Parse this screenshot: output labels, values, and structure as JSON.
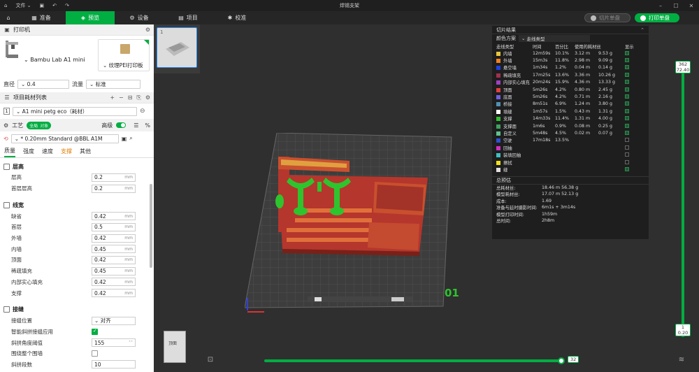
{
  "titlebar": {
    "file_menu": "文件",
    "title": "焊锡支架"
  },
  "nav": {
    "tabs": [
      "准备",
      "预览",
      "设备",
      "项目",
      "校准"
    ],
    "active_tab": "预览",
    "slice_button": "切片单盘",
    "print_button": "打印单盘"
  },
  "printer_section": {
    "title": "打印机",
    "printer_name": "Bambu Lab A1 mini",
    "plate_type": "纹理PEI打印板",
    "nozzle_label": "直径",
    "nozzle_value": "0.4",
    "flow_label": "流量",
    "flow_value": "标准"
  },
  "filament_section": {
    "title": "项目耗材列表",
    "index": "1",
    "filament": "A1 mini petg eco（耗材）"
  },
  "process_section": {
    "title": "工艺",
    "toggle_on": "全局",
    "toggle_off": "对象",
    "advanced_label": "高级",
    "preset": "* 0.20mm Standard @BBL A1M",
    "subtabs": [
      "质量",
      "强度",
      "速度",
      "支撑",
      "其他"
    ],
    "active_subtab": "质量",
    "warn_subtab": "支撑"
  },
  "settings": {
    "layer_height": {
      "title": "层高",
      "rows": [
        {
          "label": "层高",
          "value": "0.2",
          "unit": "mm"
        },
        {
          "label": "首层层高",
          "value": "0.2",
          "unit": "mm"
        }
      ]
    },
    "line_width": {
      "title": "线宽",
      "rows": [
        {
          "label": "缺省",
          "value": "0.42",
          "unit": "mm"
        },
        {
          "label": "首层",
          "value": "0.5",
          "unit": "mm"
        },
        {
          "label": "外墙",
          "value": "0.42",
          "unit": "mm"
        },
        {
          "label": "内墙",
          "value": "0.45",
          "unit": "mm"
        },
        {
          "label": "顶面",
          "value": "0.42",
          "unit": "mm"
        },
        {
          "label": "稀疏填充",
          "value": "0.45",
          "unit": "mm"
        },
        {
          "label": "内部实心填充",
          "value": "0.42",
          "unit": "mm"
        },
        {
          "label": "支撑",
          "value": "0.42",
          "unit": "mm"
        }
      ]
    },
    "seam": {
      "title": "接缝",
      "position_label": "接缝位置",
      "position_value": "对齐",
      "smart_label": "智能斜拼接缝应用",
      "angle_label": "斜拼角度阈值",
      "angle_value": "155",
      "wrap_label": "围绕整个围墙",
      "steps_label": "斜拼段数",
      "steps_value": "10"
    }
  },
  "slice_result": {
    "title": "切片结果",
    "scheme_label": "颜色方案",
    "scheme_value": "走线类型",
    "headers": [
      "走线类型",
      "时间",
      "百分比",
      "使用的耗材丝",
      "显示"
    ],
    "rows": [
      {
        "name": "内墙",
        "color": "#e8c540",
        "time": "12m59s",
        "pct": "10.1%",
        "len": "3.12 m",
        "wt": "9.53 g",
        "show": true
      },
      {
        "name": "外墙",
        "color": "#f08020",
        "time": "15m3s",
        "pct": "11.8%",
        "len": "2.98 m",
        "wt": "9.09 g",
        "show": true
      },
      {
        "name": "悬空墙",
        "color": "#2040e0",
        "time": "1m34s",
        "pct": "1.2%",
        "len": "0.04 m",
        "wt": "0.14 g",
        "show": true
      },
      {
        "name": "稀疏填充",
        "color": "#a03050",
        "time": "17m25s",
        "pct": "13.6%",
        "len": "3.36 m",
        "wt": "10.26 g",
        "show": true
      },
      {
        "name": "内部实心填充",
        "color": "#a040c0",
        "time": "20m24s",
        "pct": "15.9%",
        "len": "4.36 m",
        "wt": "13.33 g",
        "show": true
      },
      {
        "name": "顶面",
        "color": "#e04040",
        "time": "5m26s",
        "pct": "4.2%",
        "len": "0.80 m",
        "wt": "2.45 g",
        "show": true
      },
      {
        "name": "底面",
        "color": "#7060e0",
        "time": "5m26s",
        "pct": "4.2%",
        "len": "0.71 m",
        "wt": "2.16 g",
        "show": true
      },
      {
        "name": "桥接",
        "color": "#5090b0",
        "time": "8m51s",
        "pct": "6.9%",
        "len": "1.24 m",
        "wt": "3.80 g",
        "show": true
      },
      {
        "name": "填缝",
        "color": "#ffffff",
        "time": "1m57s",
        "pct": "1.5%",
        "len": "0.43 m",
        "wt": "1.31 g",
        "show": true
      },
      {
        "name": "支撑",
        "color": "#30c030",
        "time": "14m33s",
        "pct": "11.4%",
        "len": "1.31 m",
        "wt": "4.00 g",
        "show": true
      },
      {
        "name": "支撑面",
        "color": "#40a060",
        "time": "1m6s",
        "pct": "0.9%",
        "len": "0.08 m",
        "wt": "0.25 g",
        "show": true
      },
      {
        "name": "自定义",
        "color": "#60c090",
        "time": "5m48s",
        "pct": "4.5%",
        "len": "0.02 m",
        "wt": "0.07 g",
        "show": true
      },
      {
        "name": "空驶",
        "color": "#3050d0",
        "time": "17m18s",
        "pct": "13.5%",
        "len": "",
        "wt": "",
        "show": false
      },
      {
        "name": "回抽",
        "color": "#d030c0",
        "time": "",
        "pct": "",
        "len": "",
        "wt": "",
        "show": false
      },
      {
        "name": "装填回抽",
        "color": "#40c0c0",
        "time": "",
        "pct": "",
        "len": "",
        "wt": "",
        "show": false
      },
      {
        "name": "擦拭",
        "color": "#f0e020",
        "time": "",
        "pct": "",
        "len": "",
        "wt": "",
        "show": false
      },
      {
        "name": "缝",
        "color": "#e0e0e0",
        "time": "",
        "pct": "",
        "len": "",
        "wt": "",
        "show": true
      }
    ],
    "overview_title": "总预估",
    "overview": [
      {
        "k": "总耗材丝:",
        "v": "18.46 m    56.38 g"
      },
      {
        "k": "模型耗材丝:",
        "v": "17.07 m    52.13 g"
      },
      {
        "k": "成本:",
        "v": "1.69"
      },
      {
        "k": "准备与延时摄影时间:",
        "v": "6m1s + 3m14s"
      },
      {
        "k": "模型打印时间:",
        "v": "1h59m"
      },
      {
        "k": "总时间:",
        "v": "2h8m"
      }
    ]
  },
  "viewport": {
    "plate_number": "01",
    "thumb_index": "1",
    "layer_top_height": "362",
    "layer_top_z": "72.40",
    "layer_bottom_height": "1",
    "layer_bottom_z": "0.20",
    "hslider_value": "32",
    "view_cube_label": "顶面"
  }
}
